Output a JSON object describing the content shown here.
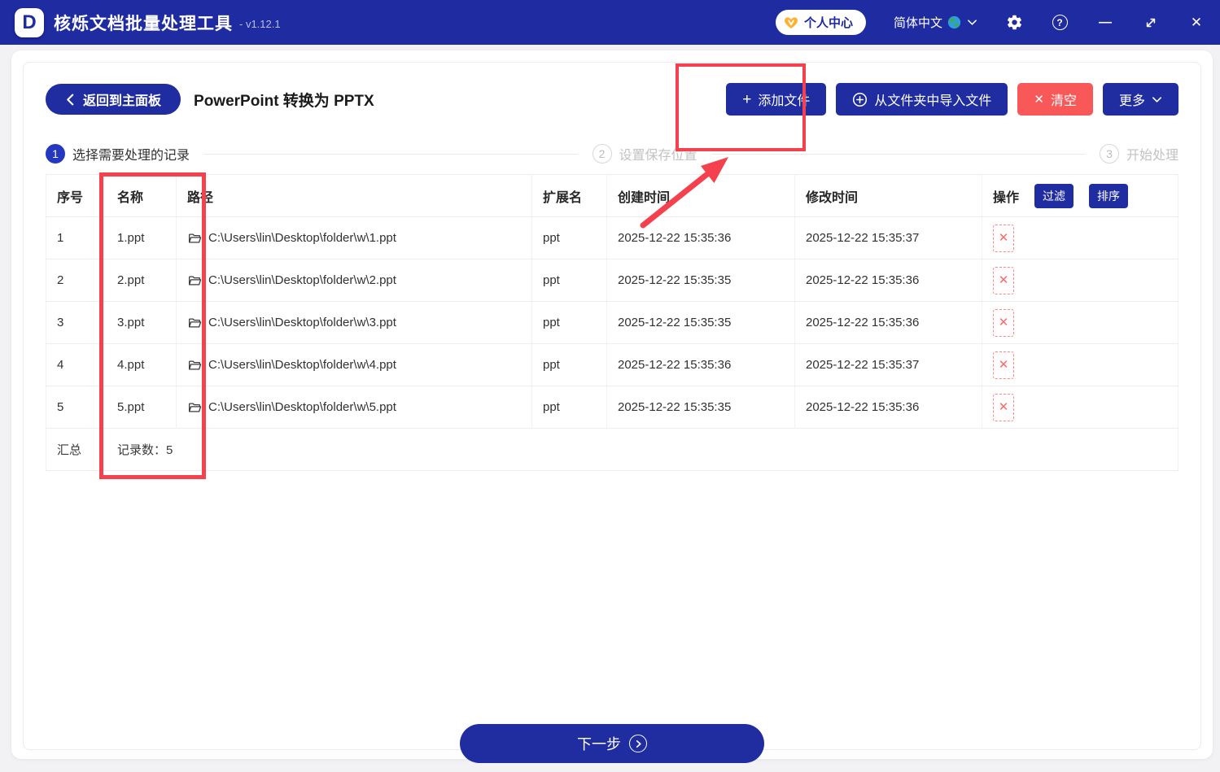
{
  "titlebar": {
    "logo_letter": "D",
    "app_title": "核烁文档批量处理工具",
    "version": "- v1.12.1",
    "user_center_label": "个人中心",
    "language_label": "简体中文"
  },
  "icons": {
    "minimize": "—",
    "close": "✕",
    "question": "?",
    "plus": "+",
    "clear_x": "✕",
    "delete_x": "✕"
  },
  "toolbar": {
    "back_label": "返回到主面板",
    "page_title": "PowerPoint 转换为 PPTX",
    "add_files_label": "添加文件",
    "import_folder_label": "从文件夹中导入文件",
    "clear_label": "清空",
    "more_label": "更多"
  },
  "steps": [
    {
      "num": "1",
      "label": "选择需要处理的记录"
    },
    {
      "num": "2",
      "label": "设置保存位置"
    },
    {
      "num": "3",
      "label": "开始处理"
    }
  ],
  "table": {
    "headers": {
      "index": "序号",
      "name": "名称",
      "path": "路径",
      "ext": "扩展名",
      "created": "创建时间",
      "modified": "修改时间",
      "action": "操作"
    },
    "filter_label": "过滤",
    "sort_label": "排序",
    "rows": [
      {
        "index": "1",
        "name": "1.ppt",
        "path": "C:\\Users\\lin\\Desktop\\folder\\w\\1.ppt",
        "ext": "ppt",
        "created": "2025-12-22 15:35:36",
        "modified": "2025-12-22 15:35:37"
      },
      {
        "index": "2",
        "name": "2.ppt",
        "path": "C:\\Users\\lin\\Desktop\\folder\\w\\2.ppt",
        "ext": "ppt",
        "created": "2025-12-22 15:35:35",
        "modified": "2025-12-22 15:35:36"
      },
      {
        "index": "3",
        "name": "3.ppt",
        "path": "C:\\Users\\lin\\Desktop\\folder\\w\\3.ppt",
        "ext": "ppt",
        "created": "2025-12-22 15:35:35",
        "modified": "2025-12-22 15:35:36"
      },
      {
        "index": "4",
        "name": "4.ppt",
        "path": "C:\\Users\\lin\\Desktop\\folder\\w\\4.ppt",
        "ext": "ppt",
        "created": "2025-12-22 15:35:36",
        "modified": "2025-12-22 15:35:37"
      },
      {
        "index": "5",
        "name": "5.ppt",
        "path": "C:\\Users\\lin\\Desktop\\folder\\w\\5.ppt",
        "ext": "ppt",
        "created": "2025-12-22 15:35:35",
        "modified": "2025-12-22 15:35:36"
      }
    ],
    "summary_label": "汇总",
    "summary_text": "记录数：5"
  },
  "footer": {
    "next_label": "下一步"
  },
  "colors": {
    "topbar": "#1f2ba0",
    "primary": "#202da0",
    "danger": "#f85858",
    "annotation_red": "#f4414d",
    "step_active": "#2438c0",
    "vip_orange": "#ffb02e"
  }
}
